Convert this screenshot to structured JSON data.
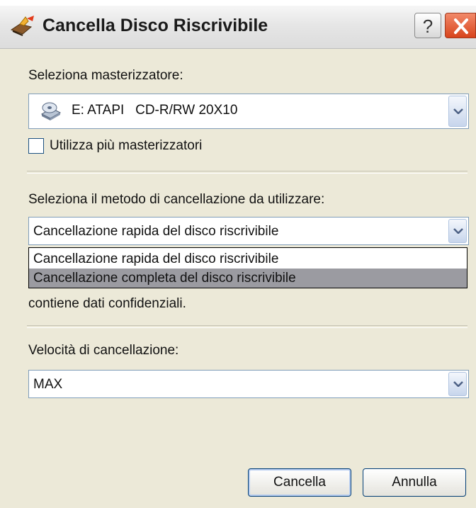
{
  "title": "Cancella Disco Riscrivibile",
  "title_buttons": {
    "help": "?",
    "close_icon": "close-icon"
  },
  "burner": {
    "label": "Seleziona masterizzatore:",
    "selected": "E: ATAPI   CD-R/RW 20X10",
    "icon": "cd-drive-icon"
  },
  "multiple_burners": {
    "label": "Utilizza più masterizzatori",
    "checked": false
  },
  "erase_method": {
    "label": "Seleziona il metodo di cancellazione da utilizzare:",
    "selected": "Cancellazione rapida del disco riscrivibile",
    "options": [
      "Cancellazione rapida del disco riscrivibile",
      "Cancellazione completa del disco riscrivibile"
    ],
    "highlighted_option_index": 1,
    "description_visible_line": "contiene dati confidenziali."
  },
  "speed": {
    "label": "Velocità di cancellazione:",
    "selected": "MAX"
  },
  "buttons": {
    "ok": "Cancella",
    "cancel": "Annulla"
  }
}
